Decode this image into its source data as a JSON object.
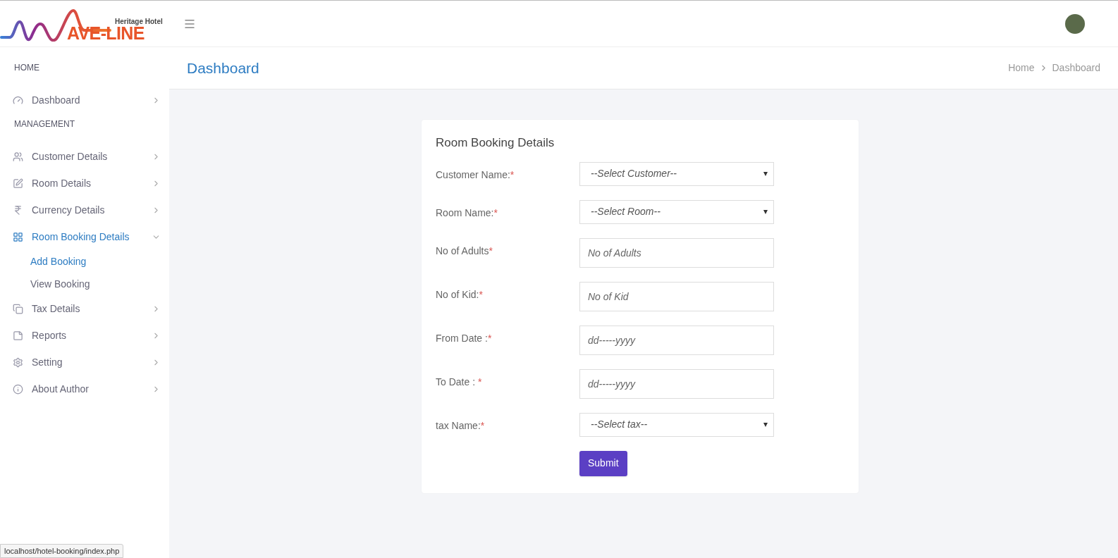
{
  "logo": {
    "tagline": "Heritage Hotel",
    "wordmark": "AVE-LINE"
  },
  "sidebar": {
    "items": [
      {
        "kind": "section",
        "label": "HOME"
      },
      {
        "kind": "link",
        "label": "Dashboard",
        "expanded": false
      },
      {
        "kind": "section",
        "label": "MANAGEMENT"
      },
      {
        "kind": "link",
        "label": "Customer Details",
        "expanded": false
      },
      {
        "kind": "link",
        "label": "Room Details",
        "expanded": false
      },
      {
        "kind": "link",
        "label": "Currency Details",
        "expanded": false
      },
      {
        "kind": "link",
        "label": "Room Booking Details",
        "expanded": true,
        "children": [
          {
            "label": "Add Booking",
            "selected": true
          },
          {
            "label": "View Booking",
            "selected": false
          }
        ]
      },
      {
        "kind": "link",
        "label": "Tax Details",
        "expanded": false
      },
      {
        "kind": "link",
        "label": "Reports",
        "expanded": false
      },
      {
        "kind": "link",
        "label": "Setting",
        "expanded": false
      },
      {
        "kind": "link",
        "label": "About Author",
        "expanded": false
      }
    ]
  },
  "page_header": {
    "title": "Dashboard",
    "breadcrumb": [
      "Home",
      "Dashboard"
    ]
  },
  "form": {
    "title": "Room Booking Details",
    "fields": [
      {
        "label": "Customer Name:",
        "required": "*",
        "kind": "select",
        "placeholder": "--Select Customer--"
      },
      {
        "label": "Room Name:",
        "required": "*",
        "kind": "select",
        "placeholder": "--Select Room--"
      },
      {
        "label": "No of Adults",
        "required": "*",
        "kind": "input",
        "placeholder": "No of Adults"
      },
      {
        "label": "No of Kid:",
        "required": "*",
        "kind": "input",
        "placeholder": "No of Kid"
      },
      {
        "label": "From Date :",
        "required": "*",
        "kind": "input",
        "placeholder": "dd-----yyyy"
      },
      {
        "label": "To Date : ",
        "required": "*",
        "kind": "input",
        "placeholder": "dd-----yyyy"
      },
      {
        "label": "tax Name:",
        "required": "*",
        "kind": "select",
        "placeholder": "--Select tax--"
      }
    ],
    "submit": "Submit"
  },
  "status_bar": "localhost/hotel-booking/index.php"
}
